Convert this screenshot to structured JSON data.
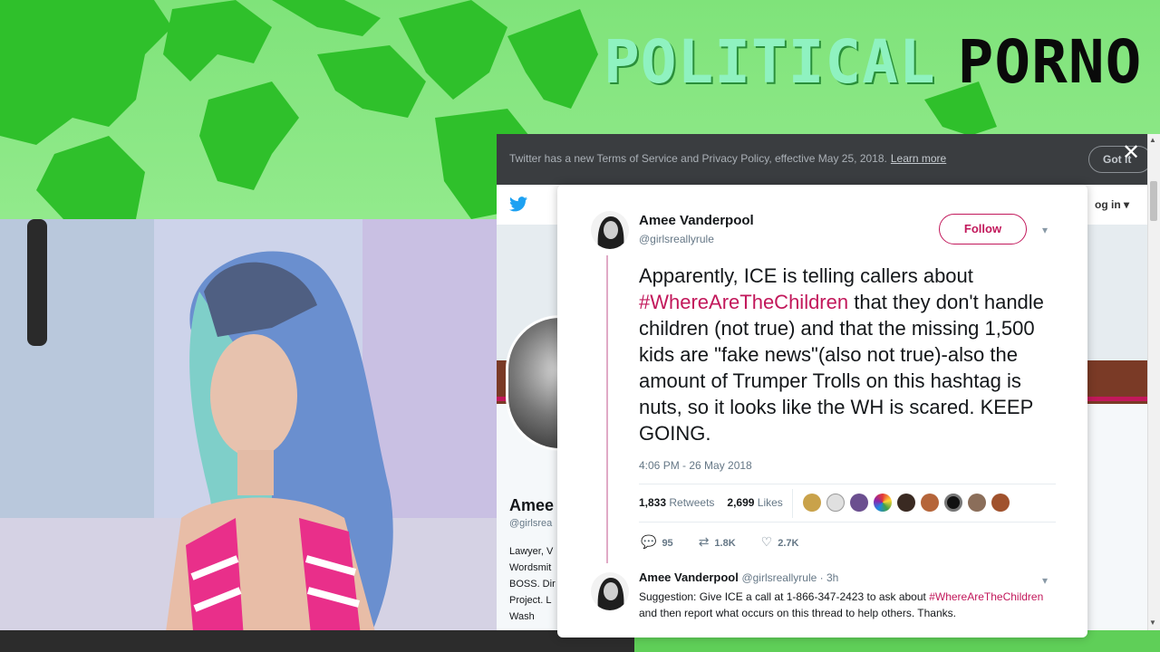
{
  "brand": {
    "word1": "POLITICAL",
    "word2": "PORNO"
  },
  "notice": {
    "text": "Twitter has a new Terms of Service and Privacy Policy, effective May 25, 2018.",
    "link": "Learn more",
    "button": "Got it",
    "close": "✕"
  },
  "nav": {
    "login": "og in"
  },
  "profile": {
    "name": "Amee",
    "handle": "@girlsrea",
    "bio_lines": [
      "Lawyer, V",
      "Wordsmit",
      "BOSS. Dir",
      "Project. L",
      "Wash"
    ]
  },
  "tweet": {
    "author": "Amee Vanderpool",
    "handle": "@girlsreallyrule",
    "follow": "Follow",
    "text_before": "Apparently, ICE is telling callers about ",
    "hashtag": "#WhereAreTheChildren",
    "text_after": " that they don't handle children (not true) and that the missing 1,500 kids are \"fake news\"(also not true)-also the amount of Trumper Trolls on this hashtag is nuts, so it looks like the WH is scared. KEEP GOING.",
    "time": "4:06 PM - 26 May 2018",
    "retweets_count": "1,833",
    "retweets_label": "Retweets",
    "likes_count": "2,699",
    "likes_label": "Likes",
    "replies": "95",
    "retweets_short": "1.8K",
    "likes_short": "2.7K"
  },
  "reply": {
    "author": "Amee Vanderpool",
    "handle_time": "@girlsreallyrule · 3h",
    "text_before": "Suggestion: Give ICE a call at 1-866-347-2423 to ask about ",
    "hashtag": "#WhereAreTheChildren",
    "text_after": " and then report what occurs on this thread to help others. Thanks."
  },
  "colors": {
    "accent": "#c2185b",
    "banner_green": "#7fe37a",
    "map_green": "#2fc02b",
    "notice_bg": "#3a3d40"
  },
  "icons": [
    "twitter-bird-icon",
    "close-icon",
    "chevron-down-icon",
    "reply-icon",
    "retweet-icon",
    "heart-icon"
  ]
}
